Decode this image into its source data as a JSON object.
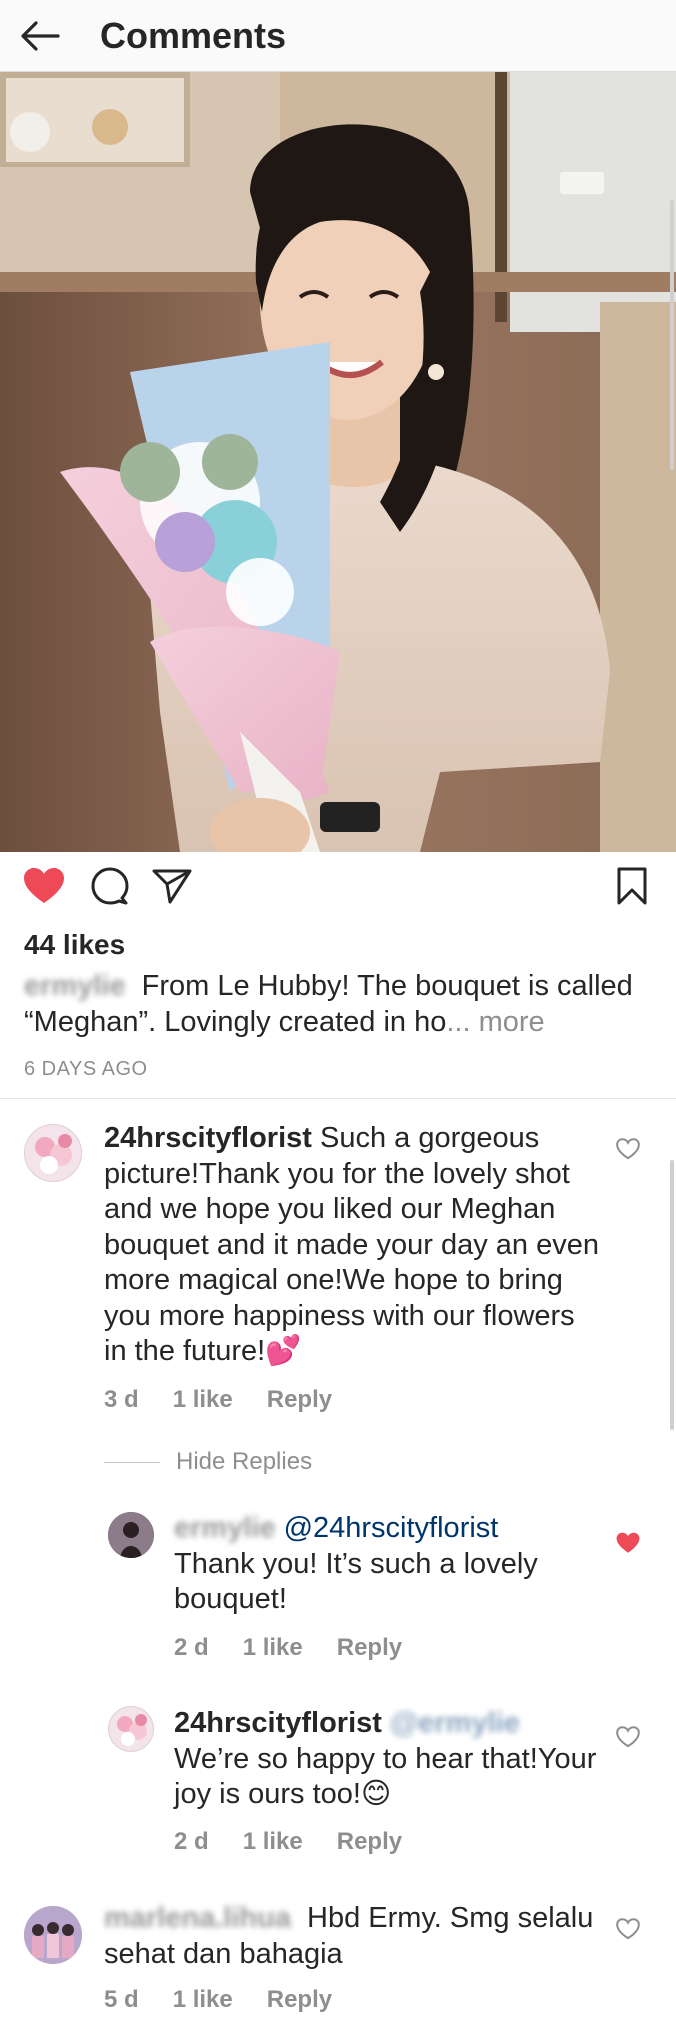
{
  "header": {
    "title": "Comments",
    "back_icon": "arrow-left-icon"
  },
  "post": {
    "likes_text": "44 likes",
    "caption_username": "ermylie",
    "caption_text": " From Le Hubby! The bouquet is called “Meghan”. Lovingly created in ho",
    "caption_ellipsis": "...",
    "caption_more": " more",
    "age": "6 DAYS AGO",
    "liked": true,
    "colors": {
      "like_red": "#ed4956",
      "text": "#262626",
      "muted": "#8e8e8e",
      "mention": "#003569"
    }
  },
  "comments": [
    {
      "username": "24hrscityflorist",
      "text": " Such a gorgeous picture!Thank you for the lovely shot and we hope you liked our Meghan bouquet and it made your day an even more magical one!We hope to bring you more happiness with our flowers in the future!💕",
      "time": "3 d",
      "likes": "1 like",
      "reply_label": "Reply",
      "liked": false,
      "hide_replies_label": "Hide Replies",
      "replies": [
        {
          "username": "ermylie",
          "mention": "@24hrscityflorist",
          "text": "Thank you! It’s such a lovely bouquet!",
          "time": "2 d",
          "likes": "1 like",
          "reply_label": "Reply",
          "liked": true
        },
        {
          "username": "24hrscityflorist",
          "mention_blurred": "@ermylie",
          "text": " We’re so happy to hear that!Your joy is ours too!😊",
          "time": "2 d",
          "likes": "1 like",
          "reply_label": "Reply",
          "liked": false
        }
      ]
    },
    {
      "username": "marlena.lihua",
      "text": " Hbd Ermy. Smg selalu sehat dan bahagia",
      "time": "5 d",
      "likes": "1 like",
      "reply_label": "Reply",
      "liked": false
    }
  ]
}
